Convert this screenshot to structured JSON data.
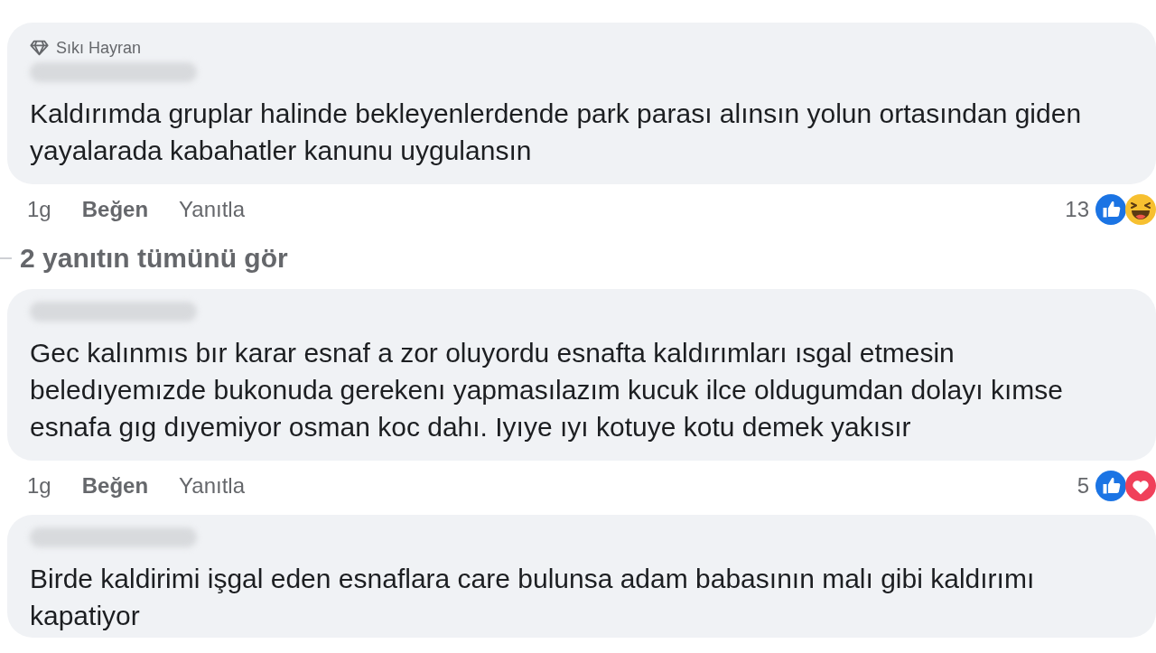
{
  "comments": [
    {
      "badge": {
        "label": "Sıkı Hayran"
      },
      "text": "Kaldırımda gruplar halinde bekleyenlerdende park parası alınsın yolun ortasından giden yayalarada kabahatler kanunu uygulansın",
      "time": "1g",
      "actions": [
        {
          "kind": "like",
          "label": "Beğen"
        },
        {
          "kind": "reply",
          "label": "Yanıtla"
        }
      ],
      "reactions": {
        "count": "13",
        "icons": [
          {
            "kind": "like"
          },
          {
            "kind": "haha"
          }
        ]
      },
      "view_replies": "2 yanıtın tümünü gör"
    },
    {
      "text": "Gec kalınmıs bır karar esnaf a zor oluyordu esnafta kaldırımları ısgal etmesin beledıyemızde bukonuda gerekenı yapmasılazım kucuk ilce oldugumdan dolayı kımse esnafa gıg dıyemiyor osman koc dahı. Iyıye ıyı kotuye kotu demek yakısır",
      "time": "1g",
      "actions": [
        {
          "kind": "like",
          "label": "Beğen"
        },
        {
          "kind": "reply",
          "label": "Yanıtla"
        }
      ],
      "reactions": {
        "count": "5",
        "icons": [
          {
            "kind": "like"
          },
          {
            "kind": "love"
          }
        ]
      }
    },
    {
      "text": "Birde kaldirimi işgal eden esnaflara care bulunsa adam babasının malı gibi kaldırımı kapatiyor"
    }
  ]
}
